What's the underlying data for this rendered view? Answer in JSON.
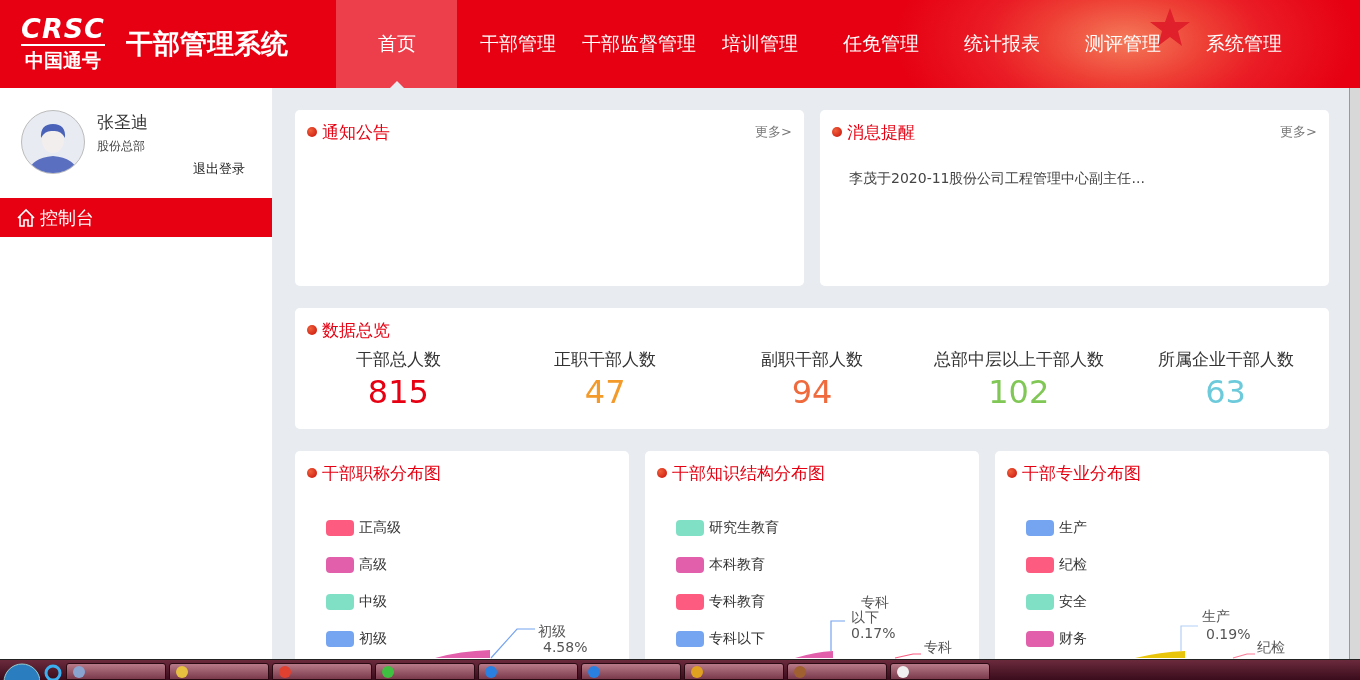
{
  "header": {
    "logo_mark": "CRSC",
    "logo_name": "中国通号",
    "system_title": "干部管理系统",
    "nav": [
      {
        "label": "首页",
        "selected": true
      },
      {
        "label": "干部管理",
        "selected": false
      },
      {
        "label": "干部监督管理",
        "selected": false
      },
      {
        "label": "培训管理",
        "selected": false
      },
      {
        "label": "任免管理",
        "selected": false
      },
      {
        "label": "统计报表",
        "selected": false
      },
      {
        "label": "测评管理",
        "selected": false
      },
      {
        "label": "系统管理",
        "selected": false
      }
    ]
  },
  "sidebar": {
    "user_name": "张圣迪",
    "department": "股份总部",
    "logout": "退出登录",
    "items": [
      {
        "label": "控制台",
        "selected": true
      }
    ]
  },
  "notice_cards": [
    {
      "title": "通知公告",
      "more": "更多>"
    },
    {
      "title": "消息提醒",
      "more": "更多>",
      "items": [
        "李茂于2020-11股份公司工程管理中心副主任..."
      ]
    }
  ],
  "overview": {
    "title": "数据总览",
    "stats": [
      {
        "label": "干部总人数",
        "value": "815",
        "color": "#e60012"
      },
      {
        "label": "正职干部人数",
        "value": "47",
        "color": "#f39a2b"
      },
      {
        "label": "副职干部人数",
        "value": "94",
        "color": "#ef6a3c"
      },
      {
        "label": "总部中层以上干部人数",
        "value": "102",
        "color": "#80c756"
      },
      {
        "label": "所属企业干部人数",
        "value": "63",
        "color": "#6ccadb"
      }
    ]
  },
  "charts": [
    {
      "title": "干部职称分布图",
      "legend": [
        {
          "name": "正高级",
          "color": "#fe5b80"
        },
        {
          "name": "高级",
          "color": "#e15fab"
        },
        {
          "name": "中级",
          "color": "#80e0c6"
        },
        {
          "name": "初级",
          "color": "#75a4f0"
        }
      ],
      "pie_labels": [
        {
          "lines": [
            "初级",
            "4.58%"
          ]
        }
      ]
    },
    {
      "title": "干部知识结构分布图",
      "legend": [
        {
          "name": "研究生教育",
          "color": "#80e0c6"
        },
        {
          "name": "本科教育",
          "color": "#e15fab"
        },
        {
          "name": "专科教育",
          "color": "#fe5b80"
        },
        {
          "name": "专科以下",
          "color": "#75a4f0"
        }
      ],
      "pie_labels": [
        {
          "lines": [
            "专科",
            "以下",
            "0.17%"
          ]
        },
        {
          "lines": [
            "专科"
          ]
        }
      ]
    },
    {
      "title": "干部专业分布图",
      "legend": [
        {
          "name": "生产",
          "color": "#75a4f0"
        },
        {
          "name": "纪检",
          "color": "#fe5b80"
        },
        {
          "name": "安全",
          "color": "#80e0c6"
        },
        {
          "name": "财务",
          "color": "#e15fab"
        }
      ],
      "pie_labels": [
        {
          "lines": [
            "生产",
            "0.19%"
          ]
        },
        {
          "lines": [
            "纪检"
          ]
        }
      ]
    }
  ]
}
